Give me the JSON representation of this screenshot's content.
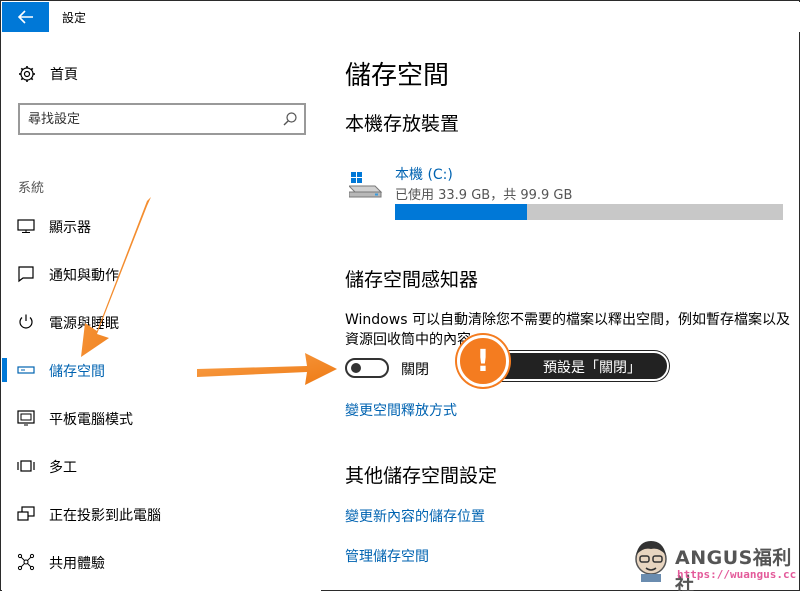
{
  "window": {
    "title": "設定"
  },
  "sidebar": {
    "home_label": "首頁",
    "search_placeholder": "尋找設定",
    "section_label": "系統",
    "items": [
      {
        "label": "顯示器",
        "icon": "monitor-icon"
      },
      {
        "label": "通知與動作",
        "icon": "notification-icon"
      },
      {
        "label": "電源與睡眠",
        "icon": "power-icon"
      },
      {
        "label": "儲存空間",
        "icon": "storage-icon",
        "active": true
      },
      {
        "label": "平板電腦模式",
        "icon": "tablet-icon"
      },
      {
        "label": "多工",
        "icon": "multitask-icon"
      },
      {
        "label": "正在投影到此電腦",
        "icon": "project-icon"
      },
      {
        "label": "共用體驗",
        "icon": "share-icon"
      }
    ]
  },
  "main": {
    "page_title": "儲存空間",
    "local_storage_heading": "本機存放裝置",
    "drive": {
      "name": "本機 (C:)",
      "usage": "已使用 33.9 GB，共 99.9 GB",
      "used_fraction": 0.339
    },
    "sense_heading": "儲存空間感知器",
    "sense_description": "Windows 可以自動清除您不需要的檔案以釋出空間，例如暫存檔案以及資源回收筒中的內容。",
    "toggle_state": "關閉",
    "change_link": "變更空間釋放方式",
    "other_heading": "其他儲存空間設定",
    "other_links": [
      "變更新內容的儲存位置",
      "管理儲存空間"
    ]
  },
  "callout": {
    "badge": "!",
    "text": "預設是「關閉」"
  },
  "watermark": {
    "brand": "ANGUS福利社",
    "url": "https://wuangus.cc"
  },
  "colors": {
    "accent": "#0078d7",
    "link": "#0063b1",
    "arrow": "#f47c20"
  }
}
